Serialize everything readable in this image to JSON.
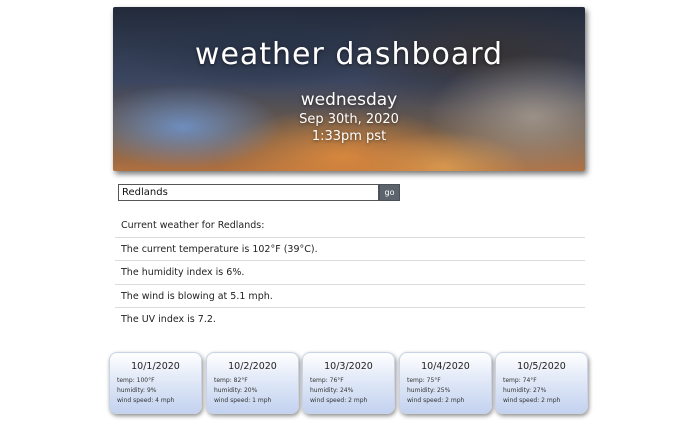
{
  "header": {
    "title": "weather dashboard",
    "day": "wednesday",
    "date": "Sep 30th, 2020",
    "time": "1:33pm pst"
  },
  "search": {
    "value": "Redlands",
    "button_label": "go"
  },
  "current": {
    "heading": "Current weather for Redlands:",
    "temperature": "The current temperature is 102°F (39°C).",
    "humidity": "The humidity index is 6%.",
    "wind": "The wind is blowing at 5.1 mph.",
    "uv": "The UV index is 7.2."
  },
  "forecast": [
    {
      "date": "10/1/2020",
      "temp": "temp: 100°F",
      "humidity": "humidity: 9%",
      "wind": "wind speed: 4 mph"
    },
    {
      "date": "10/2/2020",
      "temp": "temp: 82°F",
      "humidity": "humidity: 20%",
      "wind": "wind speed: 1 mph"
    },
    {
      "date": "10/3/2020",
      "temp": "temp: 76°F",
      "humidity": "humidity: 24%",
      "wind": "wind speed: 2 mph"
    },
    {
      "date": "10/4/2020",
      "temp": "temp: 75°F",
      "humidity": "humidity: 25%",
      "wind": "wind speed: 2 mph"
    },
    {
      "date": "10/5/2020",
      "temp": "temp: 74°F",
      "humidity": "humidity: 27%",
      "wind": "wind speed: 2 mph"
    }
  ]
}
